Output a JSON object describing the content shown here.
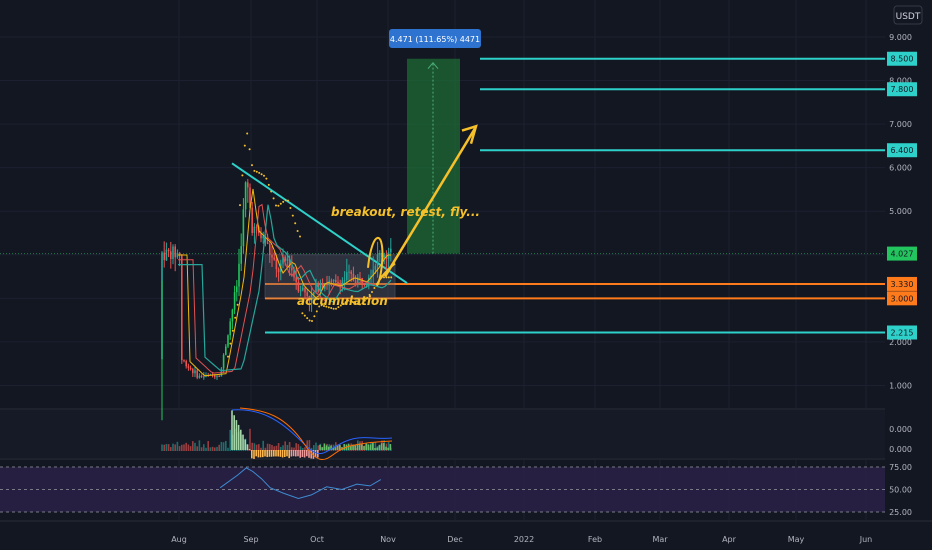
{
  "header": {
    "currency_label": "USDT"
  },
  "colors": {
    "background": "#131722",
    "grid": "#1c2030",
    "up": "#26a69a",
    "down": "#ef5350",
    "bright_up": "#22c55e",
    "cyan_level": "#2ed1c9",
    "orange_level": "#ff7a1a",
    "annotation": "#f5c02a",
    "target_box": "#1e6b35",
    "rsi_band": "#2a2147",
    "rsi_line": "#3d8bd3"
  },
  "price_pane": {
    "y_ticks": [
      "9.000",
      "8.000",
      "7.000",
      "6.000",
      "5.000",
      "4.000",
      "3.000",
      "2.000",
      "1.000",
      "0.000"
    ],
    "level_tags": [
      {
        "value": 8.5,
        "label": "8.500",
        "style": "cyan"
      },
      {
        "value": 7.8,
        "label": "7.800",
        "style": "cyan"
      },
      {
        "value": 6.4,
        "label": "6.400",
        "style": "cyan"
      },
      {
        "value": 4.027,
        "label": "4.027",
        "style": "green"
      },
      {
        "value": 3.33,
        "label": "3.330",
        "style": "orange"
      },
      {
        "value": 3.0,
        "label": "3.000",
        "style": "orange"
      },
      {
        "value": 2.215,
        "label": "2.215",
        "style": "cyan"
      }
    ],
    "measure_label": "4.471 (111.65%) 4471",
    "annotations": {
      "breakout": "breakout, retest, fly...",
      "accumulation": "accumulation"
    }
  },
  "macd_pane": {
    "y_ticks": [
      "0.000"
    ]
  },
  "rsi_pane": {
    "y_ticks": [
      "75.00",
      "50.00",
      "25.00"
    ]
  },
  "time_axis": [
    "Aug",
    "Sep",
    "Oct",
    "Nov",
    "Dec",
    "2022",
    "Feb",
    "Mar",
    "Apr",
    "May",
    "Jun"
  ],
  "chart_data": {
    "type": "candlestick",
    "quote_currency": "USDT",
    "price_range": [
      0,
      9.5
    ],
    "price": [
      [
        "2021-08-02",
        1.6
      ],
      [
        "2021-08-10",
        1.2
      ],
      [
        "2021-08-20",
        1.25
      ],
      [
        "2021-08-28",
        3.4
      ],
      [
        "2021-09-01",
        5.7
      ],
      [
        "2021-09-04",
        4.6
      ],
      [
        "2021-09-10",
        4.3
      ],
      [
        "2021-09-15",
        3.6
      ],
      [
        "2021-09-20",
        3.9
      ],
      [
        "2021-09-25",
        3.3
      ],
      [
        "2021-10-01",
        3.0
      ],
      [
        "2021-10-05",
        3.4
      ],
      [
        "2021-10-12",
        3.3
      ],
      [
        "2021-10-18",
        3.5
      ],
      [
        "2021-10-24",
        3.4
      ],
      [
        "2021-10-29",
        3.7
      ],
      [
        "2021-11-02",
        4.03
      ]
    ],
    "horizontal_levels": [
      8.5,
      7.8,
      6.4,
      4.027,
      3.33,
      3.0,
      2.215
    ],
    "target_zone": {
      "from": 4.027,
      "to": 8.5,
      "change_percent": 111.65
    },
    "rsi_levels": [
      75,
      50,
      25
    ],
    "rsi": [
      [
        "2021-08-20",
        52
      ],
      [
        "2021-08-28",
        66
      ],
      [
        "2021-09-01",
        74
      ],
      [
        "2021-09-04",
        70
      ],
      [
        "2021-09-08",
        62
      ],
      [
        "2021-09-12",
        52
      ],
      [
        "2021-09-18",
        46
      ],
      [
        "2021-09-25",
        40
      ],
      [
        "2021-10-01",
        44
      ],
      [
        "2021-10-08",
        53
      ],
      [
        "2021-10-15",
        50
      ],
      [
        "2021-10-22",
        56
      ],
      [
        "2021-10-28",
        54
      ],
      [
        "2021-11-02",
        61
      ]
    ],
    "x_ticks": [
      "Aug",
      "Sep",
      "Oct",
      "Nov",
      "Dec",
      "2022",
      "Feb",
      "Mar",
      "Apr",
      "May",
      "Jun"
    ]
  }
}
